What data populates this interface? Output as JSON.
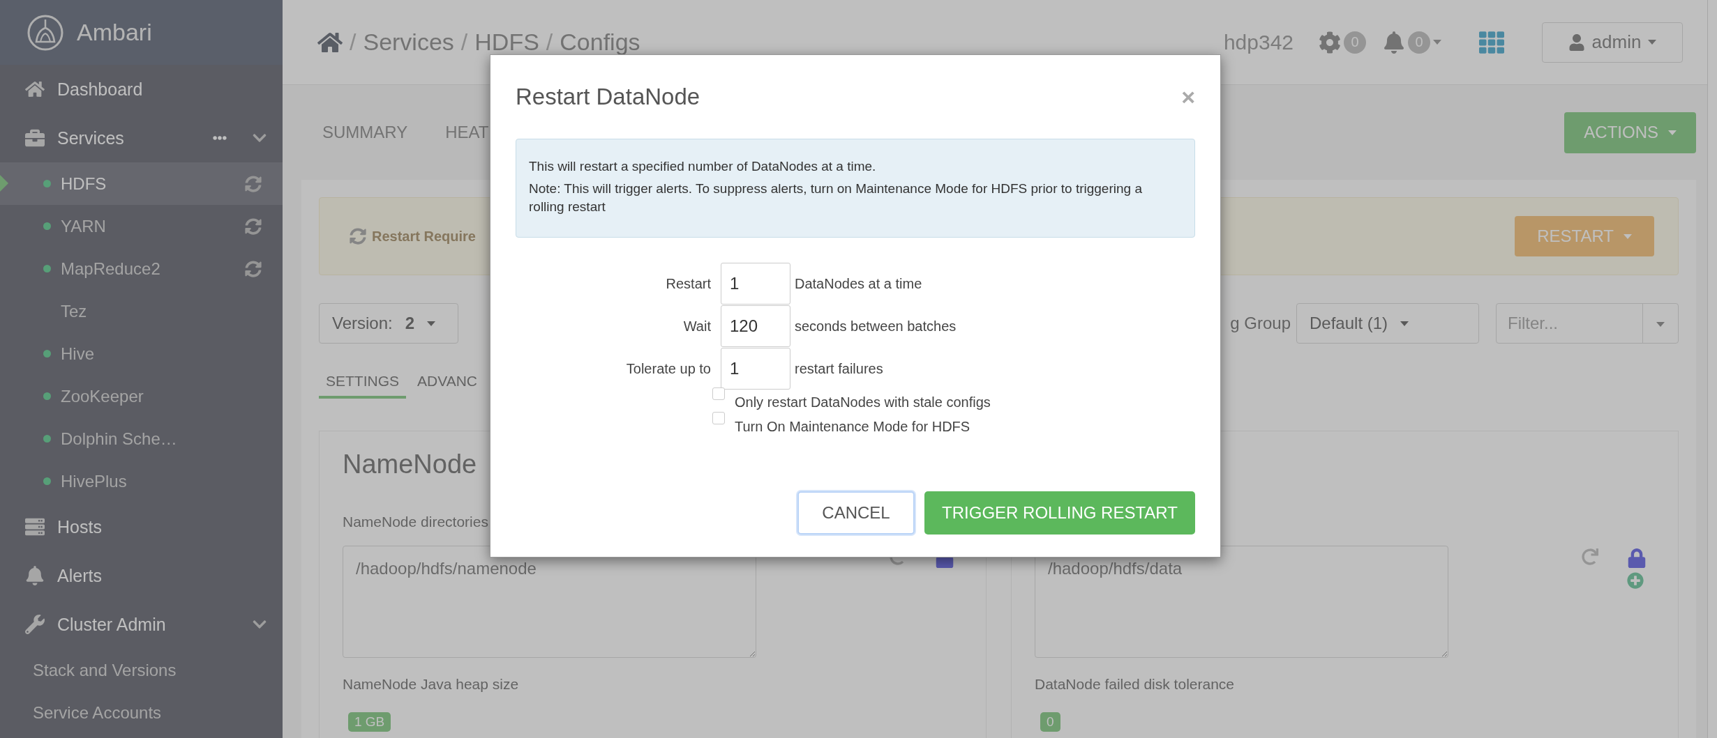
{
  "sidebar": {
    "brand": "Ambari",
    "sections": [
      {
        "label": "Dashboard"
      },
      {
        "label": "Services",
        "expanded": true,
        "menu": true,
        "children": [
          {
            "label": "HDFS",
            "selected": true,
            "started": true,
            "restart_required": true
          },
          {
            "label": "YARN",
            "selected": false,
            "started": true,
            "restart_required": true
          },
          {
            "label": "MapReduce2",
            "selected": false,
            "started": true,
            "restart_required": true
          },
          {
            "label": "Tez",
            "selected": false,
            "started": false,
            "restart_required": false
          },
          {
            "label": "Hive",
            "selected": false,
            "started": true,
            "restart_required": false
          },
          {
            "label": "ZooKeeper",
            "selected": false,
            "started": true,
            "restart_required": false
          },
          {
            "label": "Dolphin Sche…",
            "selected": false,
            "started": true,
            "restart_required": false
          },
          {
            "label": "HivePlus",
            "selected": false,
            "started": true,
            "restart_required": false
          }
        ]
      },
      {
        "label": "Hosts"
      },
      {
        "label": "Alerts"
      },
      {
        "label": "Cluster Admin",
        "expanded": true,
        "children": [
          {
            "label": "Stack and Versions",
            "selected": false
          },
          {
            "label": "Service Accounts",
            "selected": false
          }
        ]
      }
    ]
  },
  "header": {
    "breadcrumb": [
      {
        "separator": "/",
        "label": "Services"
      },
      {
        "separator": "/",
        "label": "HDFS"
      },
      {
        "separator": "/",
        "label": "Configs"
      }
    ],
    "cluster": "hdp342",
    "ops_count": "0",
    "alerts_count": "0",
    "user": "admin"
  },
  "tabs": [
    {
      "label": "SUMMARY",
      "selected": false
    },
    {
      "label": "HEAT",
      "selected": false
    }
  ],
  "actions_button": "ACTIONS",
  "restart_banner": {
    "text": "Restart Require",
    "button": "RESTART"
  },
  "version": {
    "label": "Version:",
    "value": "2"
  },
  "config_group": {
    "label": "g Group",
    "value": "Default (1)"
  },
  "filter": {
    "placeholder": "Filter..."
  },
  "subtabs": [
    {
      "label": "SETTINGS",
      "selected": true
    },
    {
      "label": "ADVANC",
      "selected": false
    }
  ],
  "cards": [
    {
      "title": "NameNode",
      "fields": [
        {
          "kind": "textarea",
          "label": "NameNode directories",
          "value": "/hadoop/hdfs/namenode",
          "add_button": false
        },
        {
          "kind": "slider",
          "label": "NameNode Java heap size",
          "value": "1 GB"
        }
      ]
    },
    {
      "fields": [
        {
          "kind": "textarea",
          "value": "/hadoop/hdfs/data",
          "add_button": true
        },
        {
          "kind": "slider",
          "label": "DataNode failed disk tolerance",
          "value": "0"
        }
      ]
    }
  ],
  "modal": {
    "title": "Restart DataNode",
    "close": "×",
    "notice": [
      "This will restart a specified number of DataNodes at a time.",
      "Note: This will trigger alerts. To suppress alerts, turn on Maintenance Mode for HDFS prior to triggering a rolling restart"
    ],
    "fields": [
      {
        "label": "Restart",
        "value": "1",
        "suffix": "DataNodes at a time"
      },
      {
        "label": "Wait",
        "value": "120",
        "suffix": "seconds between batches"
      },
      {
        "label": "Tolerate up to",
        "value": "1",
        "suffix": "restart failures"
      }
    ],
    "checkboxes": [
      {
        "label": "Only restart DataNodes with stale configs",
        "checked": false
      },
      {
        "label": "Turn On Maintenance Mode for HDFS",
        "checked": false
      }
    ],
    "cancel": "CANCEL",
    "confirm": "TRIGGER ROLLING RESTART"
  }
}
